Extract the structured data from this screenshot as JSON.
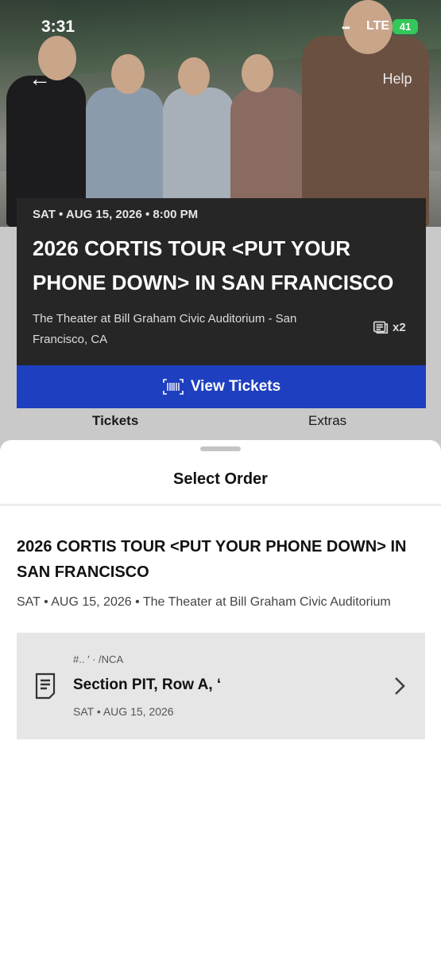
{
  "status_bar": {
    "time": "3:31",
    "signal": "•••",
    "network": "LTE",
    "battery": "41"
  },
  "header": {
    "back_icon": "back-arrow-icon",
    "help_label": "Help"
  },
  "event": {
    "date_time": "SAT • AUG 15, 2026 • 8:00 PM",
    "title": "2026 CORTIS TOUR <PUT YOUR PHONE DOWN> IN SAN FRANCISCO",
    "venue": "The Theater at Bill Graham Civic Auditorium - San Francisco, CA",
    "ticket_count": "x2",
    "ticket_icon": "tickets-icon"
  },
  "view_tickets": {
    "label": "View Tickets",
    "icon": "barcode-icon"
  },
  "tabs": [
    {
      "label": "Tickets",
      "active": true
    },
    {
      "label": "Extras",
      "active": false
    }
  ],
  "sheet": {
    "title": "Select Order",
    "order_title": "2026 CORTIS TOUR <PUT YOUR PHONE DOWN> IN SAN FRANCISCO",
    "order_subtitle": "SAT • AUG 15, 2026 • The Theater at Bill Graham Civic Auditorium",
    "orders": [
      {
        "number": "#..  ′   ·  /NCA",
        "section": "Section PIT, Row A, ‘",
        "date": "SAT • AUG 15, 2026",
        "icon": "document-icon",
        "chevron_icon": "chevron-right-icon"
      }
    ]
  },
  "colors": {
    "accent": "#1e3fbf",
    "card_dark": "#262626",
    "battery": "#34c759"
  }
}
